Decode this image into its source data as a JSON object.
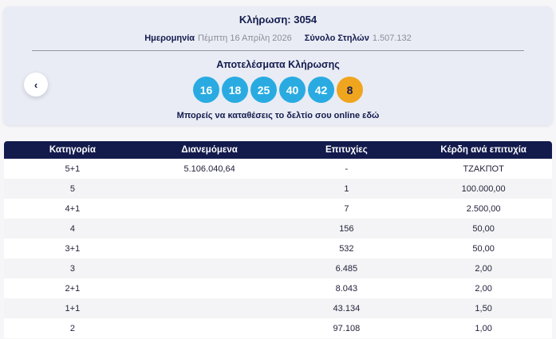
{
  "draw": {
    "title": "Κλήρωση: 3054",
    "date_label": "Ημερομηνία",
    "date_value": "Πέμπτη 16 Απρίλη 2026",
    "columns_label": "Σύνολο Στηλών",
    "columns_value": "1.507.132",
    "results_title": "Αποτελέσματα Κλήρωσης",
    "numbers": [
      "16",
      "18",
      "25",
      "40",
      "42"
    ],
    "joker": "8",
    "cta": "Μπορείς να καταθέσεις το δελτίο σου online εδώ",
    "prev_arrow": "‹"
  },
  "colors": {
    "card_bg": "#e9ecf4",
    "page_bg": "#f6f6f8",
    "navy": "#131b4e",
    "ball_blue": "#29abe2",
    "ball_orange": "#f0a51e",
    "row_alt": "#f4f4f6",
    "muted_text": "#8b8e99"
  },
  "table": {
    "headers": [
      "Κατηγορία",
      "Διανεμόμενα",
      "Επιτυχίες",
      "Κέρδη ανά επιτυχία"
    ],
    "rows": [
      {
        "category": "5+1",
        "distributed": "5.106.040,64",
        "winners": "-",
        "prize": "ΤΖΑΚΠΟΤ"
      },
      {
        "category": "5",
        "distributed": "",
        "winners": "1",
        "prize": "100.000,00"
      },
      {
        "category": "4+1",
        "distributed": "",
        "winners": "7",
        "prize": "2.500,00"
      },
      {
        "category": "4",
        "distributed": "",
        "winners": "156",
        "prize": "50,00"
      },
      {
        "category": "3+1",
        "distributed": "",
        "winners": "532",
        "prize": "50,00"
      },
      {
        "category": "3",
        "distributed": "",
        "winners": "6.485",
        "prize": "2,00"
      },
      {
        "category": "2+1",
        "distributed": "",
        "winners": "8.043",
        "prize": "2,00"
      },
      {
        "category": "1+1",
        "distributed": "",
        "winners": "43.134",
        "prize": "1,50"
      },
      {
        "category": "2",
        "distributed": "",
        "winners": "97.108",
        "prize": "1,00"
      }
    ]
  }
}
